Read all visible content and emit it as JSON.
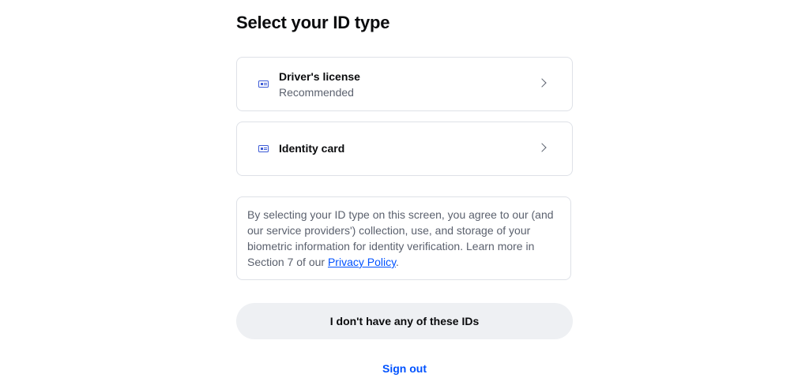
{
  "page": {
    "title": "Select your ID type"
  },
  "options": [
    {
      "title": "Driver's license",
      "subtitle": "Recommended",
      "icon": "id-card-icon"
    },
    {
      "title": "Identity card",
      "icon": "id-card-icon"
    }
  ],
  "consent": {
    "text_before": "By selecting your ID type on this screen, you agree to our (and our service providers') collection, use, and storage of your biometric information for identity verification. Learn more in Section 7 of our ",
    "link_label": "Privacy Policy",
    "text_after": "."
  },
  "actions": {
    "no_id_label": "I don't have any of these IDs",
    "sign_out_label": "Sign out"
  },
  "colors": {
    "accent": "#0052ff",
    "icon": "#3c5bd6",
    "border": "#dee1e7",
    "secondary_button_bg": "#eef0f3",
    "muted_text": "#5b616e"
  }
}
